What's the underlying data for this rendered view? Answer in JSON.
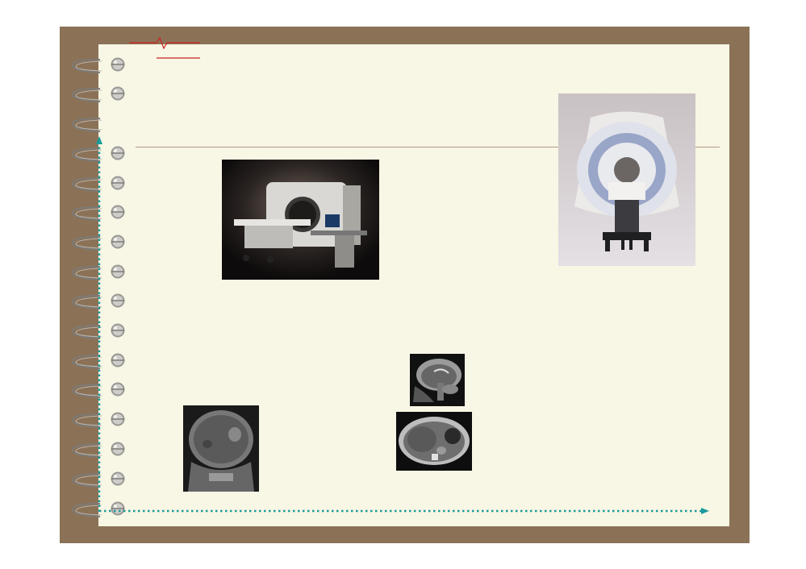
{
  "slide": {
    "title": "",
    "photos": [
      {
        "name": "mri-scanner-photo",
        "description_icon": "mri-scanner-icon"
      },
      {
        "name": "open-mri-scanner-photo",
        "description_icon": "mri-scanner-icon"
      },
      {
        "name": "coronal-brain-mri-photo",
        "description_icon": "brain-scan-icon"
      },
      {
        "name": "sagittal-brain-mri-photo",
        "description_icon": "brain-scan-icon"
      },
      {
        "name": "axial-abdomen-mri-photo",
        "description_icon": "abdomen-scan-icon"
      }
    ]
  },
  "colors": {
    "frame": "#8b7257",
    "paper": "#f8f6e4",
    "accent_red": "#cc2222",
    "axis_teal": "#1a9a9a"
  }
}
